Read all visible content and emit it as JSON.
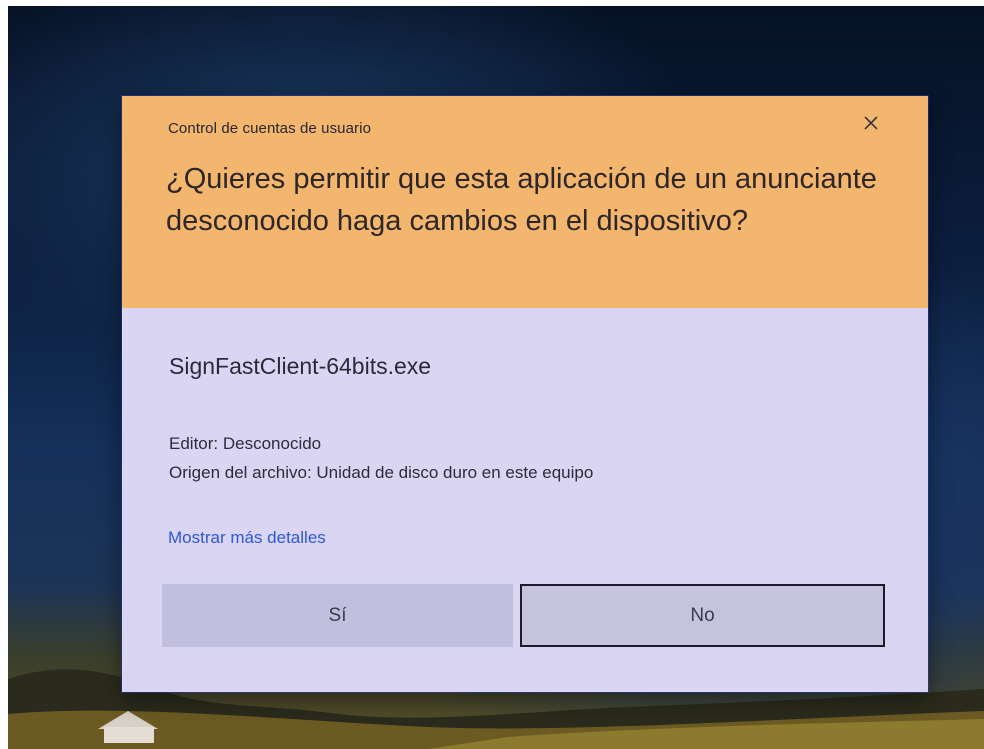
{
  "dialog": {
    "title": "Control de cuentas de usuario",
    "question": "¿Quieres permitir que esta aplicación de un anunciante desconocido haga cambios en el dispositivo?",
    "app_name": "SignFastClient-64bits.exe",
    "publisher": "Editor: Desconocido",
    "origin": "Origen del archivo: Unidad de disco duro en este equipo",
    "details_link": "Mostrar más detalles",
    "yes_label": "Sí",
    "no_label": "No",
    "close_icon": "close-icon"
  },
  "colors": {
    "header": "#f2b66e",
    "body": "#d9d5f2",
    "link": "#2f57d6",
    "buttons": "#c4c0de"
  }
}
